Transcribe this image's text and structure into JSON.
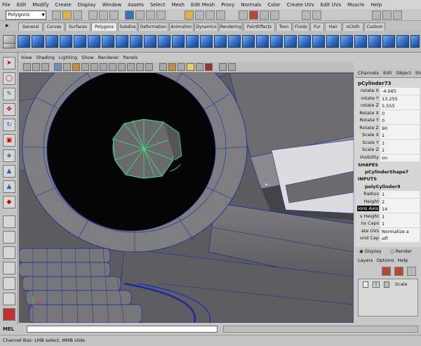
{
  "menubar": [
    "File",
    "Edit",
    "Modify",
    "Create",
    "Display",
    "Window",
    "Assets",
    "Select",
    "Mesh",
    "Edit Mesh",
    "Proxy",
    "Normals",
    "Color",
    "Create UVs",
    "Edit UVs",
    "Muscle",
    "Help"
  ],
  "status": {
    "mode": "Polygons"
  },
  "shelf_tabs": [
    "General",
    "Curves",
    "Surfaces",
    "Polygons",
    "Subdivs",
    "Deformation",
    "Animation",
    "Dynamics",
    "Rendering",
    "PaintEffects",
    "Toon",
    "Fluids",
    "Fur",
    "Hair",
    "nCloth",
    "Custom"
  ],
  "shelf_active_tab": "Polygons",
  "panel_menu": [
    "View",
    "Shading",
    "Lighting",
    "Show",
    "Renderer",
    "Panels"
  ],
  "channel_box": {
    "menu": [
      "Channels",
      "Edit",
      "Object",
      "Sh"
    ],
    "object": "pCylinder73",
    "attributes": [
      {
        "name": "rotate X",
        "value": "-4.085"
      },
      {
        "name": "rotate Y",
        "value": "13.255"
      },
      {
        "name": "rotate Z",
        "value": "5.555"
      },
      {
        "name": "Rotate X",
        "value": "0"
      },
      {
        "name": "Rotate Y",
        "value": "0"
      },
      {
        "name": "Rotate Z",
        "value": "90"
      },
      {
        "name": "Scale X",
        "value": "1"
      },
      {
        "name": "Scale Y",
        "value": "1"
      },
      {
        "name": "Scale Z",
        "value": "1"
      },
      {
        "name": "Visibility",
        "value": "on"
      }
    ],
    "shapes_label": "SHAPES",
    "shape_node": "pCylinderShape7",
    "inputs_label": "INPUTS",
    "input_node": "polyCylinder9",
    "input_attributes": [
      {
        "name": "Radius",
        "value": "1"
      },
      {
        "name": "Height",
        "value": "2"
      },
      {
        "name": "ions Axis",
        "value": "14"
      },
      {
        "name": "s Height",
        "value": "1"
      },
      {
        "name": "ns Caps",
        "value": "1"
      },
      {
        "name": "ate UVs",
        "value": "Normalize a"
      },
      {
        "name": "und Cap",
        "value": "off"
      }
    ]
  },
  "display_row": {
    "display": "Display",
    "render": "Render"
  },
  "layer_menu": [
    "Layers",
    "Options",
    "Help"
  ],
  "layer_row": {
    "t": "T",
    "name": "Scale"
  },
  "bottom": {
    "mel_label": "MEL",
    "help": "Channel Box: LMB select, MMB slide"
  },
  "colors": {
    "wireframe_selected": "#3ee08a",
    "wireframe": "#1d2a9a",
    "mesh": "#6b6b70"
  }
}
